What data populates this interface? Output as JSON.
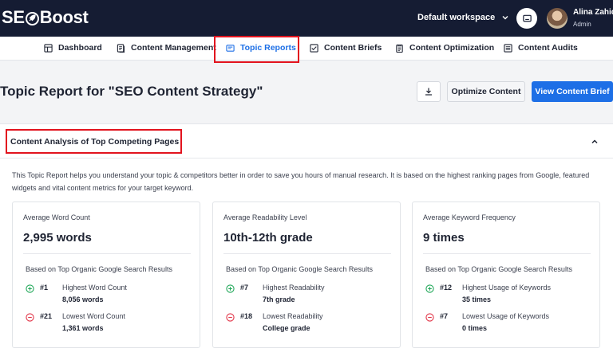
{
  "brand": {
    "logo_prefix": "SE",
    "logo_suffix": "Boost"
  },
  "header": {
    "workspace": "Default workspace",
    "user_name": "Alina Zahid",
    "user_role": "Admin"
  },
  "nav": {
    "items": [
      {
        "label": "Dashboard",
        "icon": "layout-icon"
      },
      {
        "label": "Content Management",
        "icon": "document-stack-icon"
      },
      {
        "label": "Topic Reports",
        "icon": "report-icon",
        "active": true
      },
      {
        "label": "Content Briefs",
        "icon": "checklist-icon"
      },
      {
        "label": "Content Optimization",
        "icon": "clipboard-icon"
      },
      {
        "label": "Content Audits",
        "icon": "audit-list-icon"
      }
    ]
  },
  "page": {
    "title": "Topic Report for \"SEO Content Strategy\"",
    "optimize_label": "Optimize Content",
    "view_brief_label": "View Content Brief"
  },
  "panel": {
    "title": "Content Analysis of Top Competing Pages",
    "description": "This Topic Report helps you understand your topic & competitors better in order to save you hours of manual research. It is based on the highest ranking pages from Google, featured widgets and vital content metrics for your target keyword.",
    "cards": [
      {
        "label": "Average Word Count",
        "value": "2,995 words",
        "source": "Based on Top Organic Google Search Results",
        "high": {
          "rank": "#1",
          "title": "Highest Word Count",
          "value": "8,056 words"
        },
        "low": {
          "rank": "#21",
          "title": "Lowest Word Count",
          "value": "1,361 words"
        }
      },
      {
        "label": "Average Readability Level",
        "value": "10th-12th grade",
        "source": "Based on Top Organic Google Search Results",
        "high": {
          "rank": "#7",
          "title": "Highest Readability",
          "value": "7th grade"
        },
        "low": {
          "rank": "#18",
          "title": "Lowest Readability",
          "value": "College grade"
        }
      },
      {
        "label": "Average Keyword Frequency",
        "value": "9 times",
        "source": "Based on Top Organic Google Search Results",
        "high": {
          "rank": "#12",
          "title": "Highest Usage of Keywords",
          "value": "35 times"
        },
        "low": {
          "rank": "#7",
          "title": "Lowest Usage of Keywords",
          "value": "0 times"
        }
      }
    ]
  },
  "colors": {
    "topbar": "#151c33",
    "accent": "#1d6fe6",
    "highlight": "#e2131e",
    "positive": "#22a85a",
    "negative": "#e2374a"
  }
}
